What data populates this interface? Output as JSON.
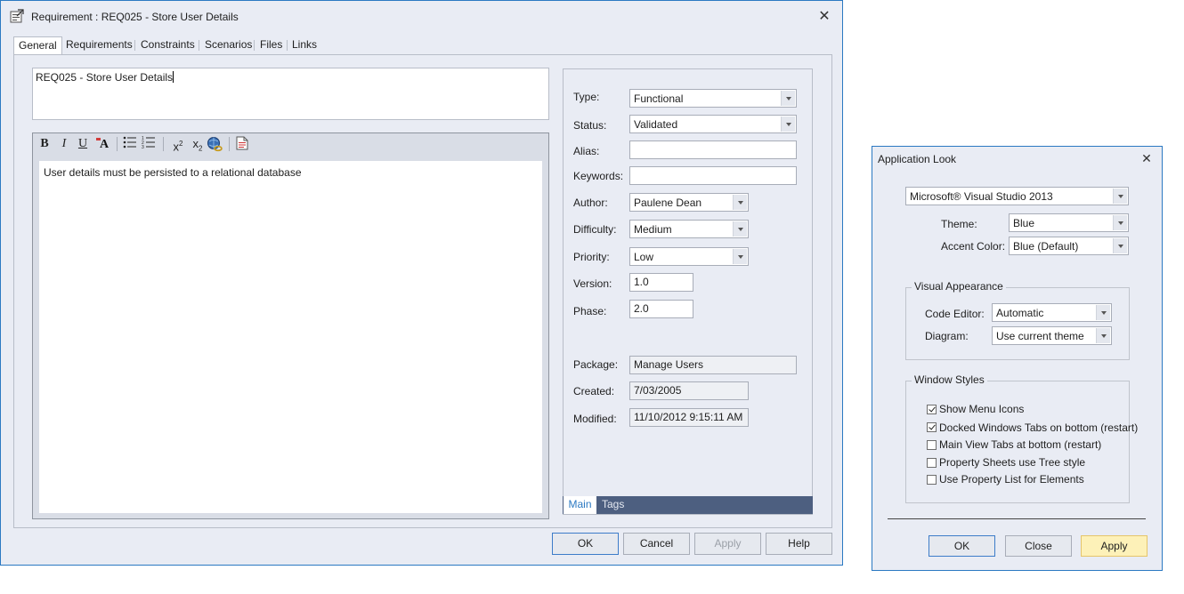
{
  "req_dialog": {
    "title": "Requirement : REQ025 - Store User Details",
    "tabs": [
      "General",
      "Requirements",
      "Constraints",
      "Scenarios",
      "Files",
      "Links"
    ],
    "name_value": "REQ025 - Store User Details",
    "notes_text": "User details must be persisted to a relational database",
    "toolbar": {
      "bold": "B",
      "italic": "I",
      "underline": "U",
      "font_color": "A",
      "superscript": "x",
      "superscript_mark": "2",
      "subscript": "x",
      "subscript_mark": "2"
    },
    "props": {
      "type_label": "Type:",
      "type_value": "Functional",
      "status_label": "Status:",
      "status_value": "Validated",
      "alias_label": "Alias:",
      "alias_value": "",
      "keywords_label": "Keywords:",
      "keywords_value": "",
      "author_label": "Author:",
      "author_value": "Paulene Dean",
      "difficulty_label": "Difficulty:",
      "difficulty_value": "Medium",
      "priority_label": "Priority:",
      "priority_value": "Low",
      "version_label": "Version:",
      "version_value": "1.0",
      "phase_label": "Phase:",
      "phase_value": "2.0",
      "package_label": "Package:",
      "package_value": "Manage Users",
      "created_label": "Created:",
      "created_value": "7/03/2005",
      "modified_label": "Modified:",
      "modified_value": "11/10/2012 9:15:11 AM"
    },
    "bottom_tabs": {
      "main": "Main",
      "tags": "Tags"
    },
    "buttons": {
      "ok": "OK",
      "cancel": "Cancel",
      "apply": "Apply",
      "help": "Help"
    }
  },
  "look_dialog": {
    "title": "Application Look",
    "style_value": "Microsoft® Visual Studio 2013",
    "theme_label": "Theme:",
    "theme_value": "Blue",
    "accent_label": "Accent Color:",
    "accent_value": "Blue (Default)",
    "visual_group": "Visual Appearance",
    "code_editor_label": "Code Editor:",
    "code_editor_value": "Automatic",
    "diagram_label": "Diagram:",
    "diagram_value": "Use current theme",
    "window_group": "Window Styles",
    "checkboxes": [
      {
        "label": "Show Menu Icons",
        "checked": true
      },
      {
        "label": "Docked Windows Tabs on bottom (restart)",
        "checked": true
      },
      {
        "label": "Main View Tabs at bottom (restart)",
        "checked": false
      },
      {
        "label": "Property Sheets use Tree style",
        "checked": false
      },
      {
        "label": "Use Property List for Elements",
        "checked": false
      }
    ],
    "buttons": {
      "ok": "OK",
      "close": "Close",
      "apply": "Apply"
    }
  },
  "colors": {
    "window_bg": "#e9ecf4",
    "window_border": "#2b79c2",
    "bottom_tab_bar": "#4d5f80",
    "bottom_tab_active_text": "#2b79c2",
    "apply_highlight": "#fdf1b8"
  },
  "icons": {
    "title_icon": "requirement-properties-icon",
    "close": "close-icon",
    "bullet_list": "bullet-list-icon",
    "numbered_list": "numbered-list-icon",
    "hyperlink": "hyperlink-globe-icon",
    "insert_document": "document-icon"
  }
}
